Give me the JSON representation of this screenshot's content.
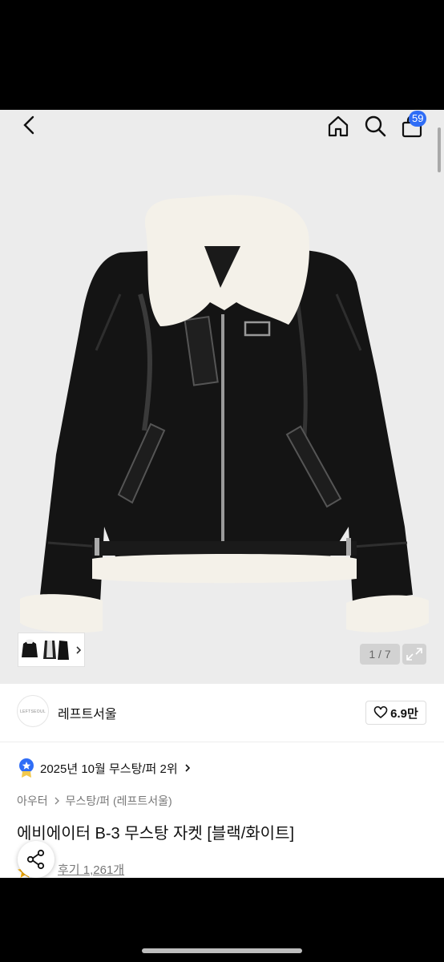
{
  "header": {
    "cart_count": "59"
  },
  "gallery": {
    "counter": "1 / 7"
  },
  "brand": {
    "logo_text": "LEFTSEOUL",
    "name": "레프트서울",
    "likes": "6.9만"
  },
  "ranking": {
    "text": "2025년 10월 무스탕/퍼 2위"
  },
  "breadcrumb": {
    "category": "아우터",
    "subcategory": "무스탕/퍼 (레프트서울)"
  },
  "product": {
    "title": "에비에이터 B-3 무스탕 자켓 [블랙/화이트]",
    "reviews": "후기 1,261개"
  },
  "colors": {
    "accent": "#2f6df6",
    "hero_bg": "#ececec"
  }
}
